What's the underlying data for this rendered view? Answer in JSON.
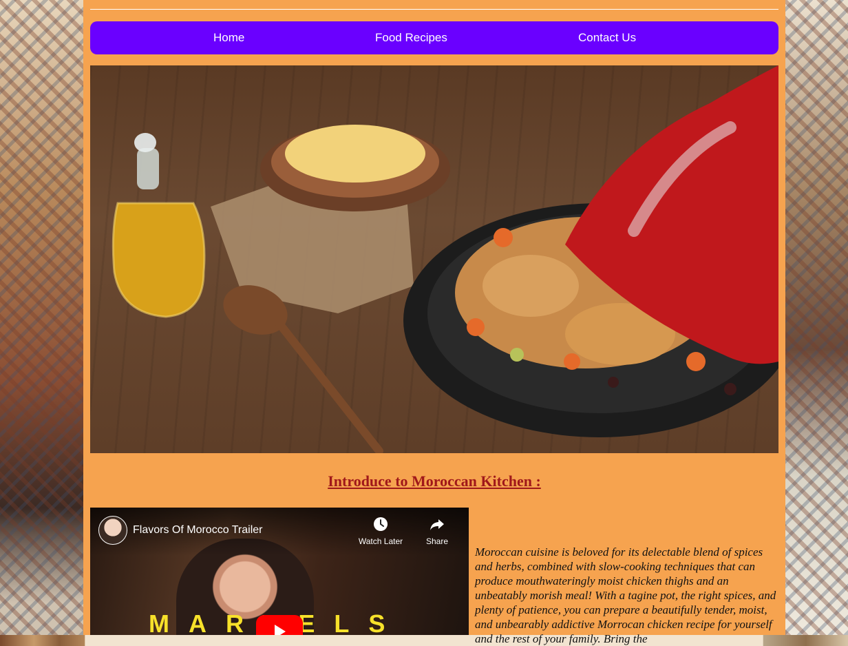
{
  "nav": {
    "home": "Home",
    "recipes": "Food Recipes",
    "contact": "Contact Us"
  },
  "section": {
    "title": "Introduce to Moroccan Kitchen :"
  },
  "video": {
    "title": "Flavors Of Morocco Trailer",
    "watch_later": "Watch Later",
    "share": "Share",
    "overlay_word": "MARVELS"
  },
  "intro": {
    "text": "Moroccan cuisine is beloved for its delectable blend of spices and herbs, combined with slow-cooking techniques that can produce mouthwateringly moist chicken thighs and an unbeatably morish meal! With a tagine pot, the right spices, and plenty of patience, you can prepare a beautifully tender, moist, and unbearably addictive Morrocan chicken recipe for yourself and the rest of your family. Bring the"
  },
  "colors": {
    "page_bg": "#f6a34f",
    "nav_bg": "#6a00ff",
    "title_color": "#a0181a"
  }
}
